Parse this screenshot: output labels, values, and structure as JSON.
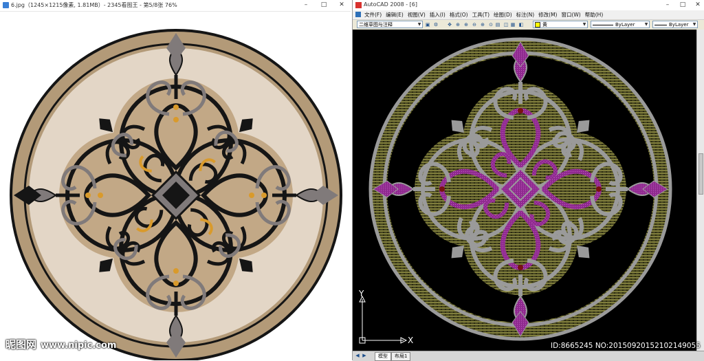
{
  "viewer": {
    "title": "6.jpg（1245×1215像素, 1.81MB）- 2345看图王 - 第5/8张 76%",
    "minimize": "–",
    "maximize": "□",
    "close": "✕",
    "watermark_logo": "昵图网",
    "watermark_url": "www.nipic.com"
  },
  "cad": {
    "title": "AutoCAD 2008 - [6]",
    "minimize": "–",
    "maximize": "□",
    "close": "✕",
    "menu": [
      "文件(F)",
      "编辑(E)",
      "视图(V)",
      "插入(I)",
      "格式(O)",
      "工具(T)",
      "绘图(D)",
      "标注(N)",
      "修改(M)",
      "窗口(W)",
      "帮助(H)"
    ],
    "workspace_combo": "二维草图与注释",
    "color_combo": "黄",
    "linetype_combo": "ByLayer",
    "lineweight_combo": "ByLayer",
    "axis_y": "Y",
    "axis_x": "X",
    "tabs": [
      "模型",
      "布局1"
    ],
    "id_mark": "ID:8665245 NO:20150920152102149055"
  },
  "colors": {
    "marble_light": "#e3d6c6",
    "marble_brown": "#b39a78",
    "inlay_black": "#151515",
    "inlay_grey": "#807a7a",
    "inlay_gold": "#d99a2b",
    "cad_bg": "#000000",
    "cad_grey": "#9a9a9a",
    "cad_purple": "#8e2a8e",
    "cad_hatch": "#b9b65a",
    "cad_red": "#7a1212"
  }
}
